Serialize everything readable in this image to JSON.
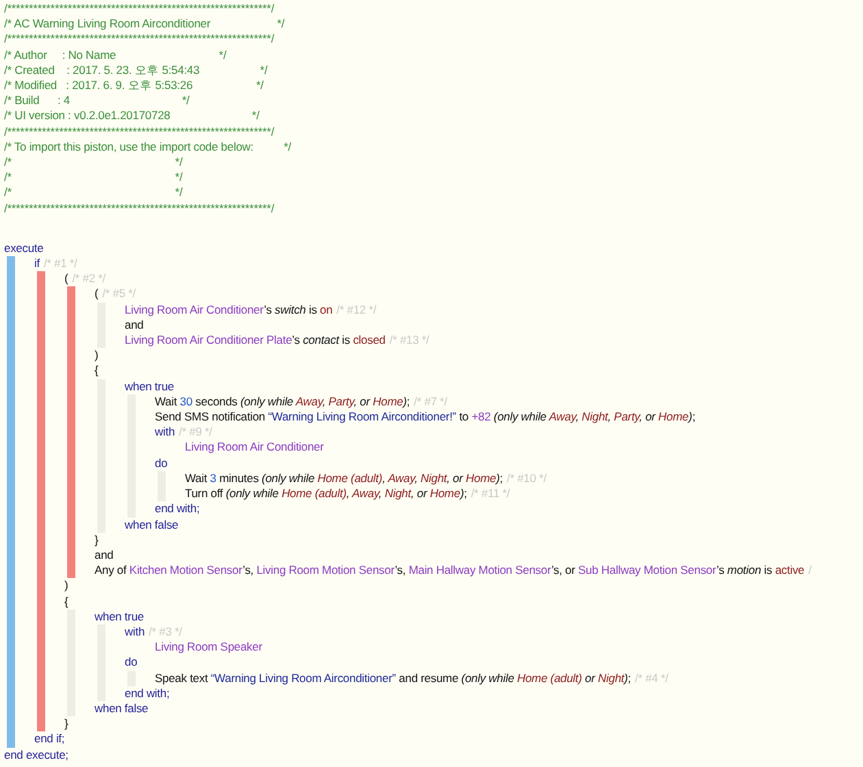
{
  "header": [
    "/*************************************************************/",
    "/* AC Warning Living Room Airconditioner                      */",
    "/*************************************************************/",
    "/* Author     : No Name                                  */",
    "/* Created    : 2017. 5. 23. 오후 5:54:43                    */",
    "/* Modified   : 2017. 6. 9. 오후 5:53:26                     */",
    "/* Build      : 4                                     */",
    "/* UI version : v0.2.0e1.20170728                           */",
    "/*************************************************************/",
    "/* To import this piston, use the import code below:          */",
    "/*                                                      */",
    "/*                                                      */",
    "/*                                                      */",
    "/*************************************************************/"
  ],
  "code": [
    {
      "segments": [
        {
          "kind": "kw",
          "text": "execute"
        }
      ],
      "kind": "execute",
      "children": [
        {
          "segments": [
            {
              "kind": "kw",
              "text": "if"
            },
            {
              "kind": "cm",
              "text": "/* #1 */"
            }
          ],
          "kind": "condition",
          "children": [
            {
              "segments": [
                {
                  "kind": "tx",
                  "text": "("
                },
                {
                  "kind": "cm",
                  "text": "/* #2 */"
                }
              ],
              "kind": "condition",
              "children": [
                {
                  "segments": [
                    {
                      "kind": "tx",
                      "text": "("
                    },
                    {
                      "kind": "cm",
                      "text": "/* #5 */"
                    }
                  ],
                  "kind": "block",
                  "children": [
                    {
                      "segments": [
                        {
                          "kind": "dv",
                          "text": "Living Room Air Conditioner"
                        },
                        {
                          "kind": "tx",
                          "text": "’s "
                        },
                        {
                          "kind": "at",
                          "text": "switch"
                        },
                        {
                          "kind": "tx",
                          "text": " is "
                        },
                        {
                          "kind": "vl",
                          "text": "on"
                        },
                        {
                          "kind": "cm",
                          "text": "/* #12 */"
                        }
                      ]
                    },
                    {
                      "segments": [
                        {
                          "kind": "tx",
                          "text": "and"
                        }
                      ]
                    },
                    {
                      "segments": [
                        {
                          "kind": "dv",
                          "text": "Living Room Air Conditioner Plate"
                        },
                        {
                          "kind": "tx",
                          "text": "’s "
                        },
                        {
                          "kind": "at",
                          "text": "contact"
                        },
                        {
                          "kind": "tx",
                          "text": " is "
                        },
                        {
                          "kind": "vl",
                          "text": "closed"
                        },
                        {
                          "kind": "cm",
                          "text": "/* #13 */"
                        }
                      ]
                    }
                  ]
                },
                {
                  "segments": [
                    {
                      "kind": "tx",
                      "text": ")"
                    }
                  ]
                },
                {
                  "segments": [
                    {
                      "kind": "tx",
                      "text": "{"
                    }
                  ],
                  "kind": "block",
                  "children": [
                    {
                      "segments": [
                        {
                          "kind": "kw",
                          "text": "when true"
                        }
                      ],
                      "kind": "block",
                      "children": [
                        {
                          "segments": [
                            {
                              "kind": "tx",
                              "text": "Wait "
                            },
                            {
                              "kind": "nm",
                              "text": "30"
                            },
                            {
                              "kind": "tx",
                              "text": " seconds "
                            },
                            {
                              "kind": "it",
                              "text": "(only while "
                            },
                            {
                              "kind": "md",
                              "text": "Away"
                            },
                            {
                              "kind": "it",
                              "text": ", "
                            },
                            {
                              "kind": "md",
                              "text": "Party"
                            },
                            {
                              "kind": "it",
                              "text": ", or "
                            },
                            {
                              "kind": "md",
                              "text": "Home"
                            },
                            {
                              "kind": "it",
                              "text": ")"
                            },
                            {
                              "kind": "tx",
                              "text": ";"
                            },
                            {
                              "kind": "cm",
                              "text": "/* #7 */"
                            }
                          ]
                        },
                        {
                          "segments": [
                            {
                              "kind": "tx",
                              "text": "Send SMS notification "
                            },
                            {
                              "kind": "st",
                              "text": "“Warning Living Room Airconditioner!”"
                            },
                            {
                              "kind": "tx",
                              "text": " to "
                            },
                            {
                              "kind": "dv",
                              "text": "+82"
                            },
                            {
                              "kind": "it",
                              "text": " (only while "
                            },
                            {
                              "kind": "md",
                              "text": "Away"
                            },
                            {
                              "kind": "it",
                              "text": ", "
                            },
                            {
                              "kind": "md",
                              "text": "Night"
                            },
                            {
                              "kind": "it",
                              "text": ", "
                            },
                            {
                              "kind": "md",
                              "text": "Party"
                            },
                            {
                              "kind": "it",
                              "text": ", or "
                            },
                            {
                              "kind": "md",
                              "text": "Home"
                            },
                            {
                              "kind": "it",
                              "text": ")"
                            },
                            {
                              "kind": "tx",
                              "text": ";"
                            }
                          ]
                        },
                        {
                          "segments": [
                            {
                              "kind": "kw",
                              "text": "with"
                            },
                            {
                              "kind": "cm",
                              "text": "/* #9 */"
                            }
                          ],
                          "kind": "group",
                          "children": [
                            {
                              "segments": [
                                {
                                  "kind": "dv",
                                  "text": "Living Room Air Conditioner"
                                }
                              ]
                            }
                          ]
                        },
                        {
                          "segments": [
                            {
                              "kind": "kw",
                              "text": "do"
                            }
                          ],
                          "kind": "block",
                          "children": [
                            {
                              "segments": [
                                {
                                  "kind": "tx",
                                  "text": "Wait "
                                },
                                {
                                  "kind": "nm",
                                  "text": "3"
                                },
                                {
                                  "kind": "tx",
                                  "text": " minutes "
                                },
                                {
                                  "kind": "it",
                                  "text": "(only while "
                                },
                                {
                                  "kind": "md",
                                  "text": "Home (adult)"
                                },
                                {
                                  "kind": "it",
                                  "text": ", "
                                },
                                {
                                  "kind": "md",
                                  "text": "Away"
                                },
                                {
                                  "kind": "it",
                                  "text": ", "
                                },
                                {
                                  "kind": "md",
                                  "text": "Night"
                                },
                                {
                                  "kind": "it",
                                  "text": ", or "
                                },
                                {
                                  "kind": "md",
                                  "text": "Home"
                                },
                                {
                                  "kind": "it",
                                  "text": ")"
                                },
                                {
                                  "kind": "tx",
                                  "text": ";"
                                },
                                {
                                  "kind": "cm",
                                  "text": "/* #10 */"
                                }
                              ]
                            },
                            {
                              "segments": [
                                {
                                  "kind": "tx",
                                  "text": "Turn off "
                                },
                                {
                                  "kind": "it",
                                  "text": "(only while "
                                },
                                {
                                  "kind": "md",
                                  "text": "Home (adult)"
                                },
                                {
                                  "kind": "it",
                                  "text": ", "
                                },
                                {
                                  "kind": "md",
                                  "text": "Away"
                                },
                                {
                                  "kind": "it",
                                  "text": ", "
                                },
                                {
                                  "kind": "md",
                                  "text": "Night"
                                },
                                {
                                  "kind": "it",
                                  "text": ", or "
                                },
                                {
                                  "kind": "md",
                                  "text": "Home"
                                },
                                {
                                  "kind": "it",
                                  "text": ")"
                                },
                                {
                                  "kind": "tx",
                                  "text": ";"
                                },
                                {
                                  "kind": "cm",
                                  "text": "/* #11 */"
                                }
                              ]
                            }
                          ]
                        },
                        {
                          "segments": [
                            {
                              "kind": "kw",
                              "text": "end with;"
                            }
                          ]
                        }
                      ]
                    },
                    {
                      "segments": [
                        {
                          "kind": "kw",
                          "text": "when false"
                        }
                      ]
                    }
                  ]
                },
                {
                  "segments": [
                    {
                      "kind": "tx",
                      "text": "}"
                    }
                  ]
                },
                {
                  "segments": [
                    {
                      "kind": "tx",
                      "text": "and"
                    }
                  ]
                },
                {
                  "segments": [
                    {
                      "kind": "tx",
                      "text": "Any of "
                    },
                    {
                      "kind": "dv",
                      "text": "Kitchen Motion Sensor"
                    },
                    {
                      "kind": "tx",
                      "text": "’s, "
                    },
                    {
                      "kind": "dv",
                      "text": "Living Room Motion Sensor"
                    },
                    {
                      "kind": "tx",
                      "text": "’s, "
                    },
                    {
                      "kind": "dv",
                      "text": "Main Hallway Motion Sensor"
                    },
                    {
                      "kind": "tx",
                      "text": "’s, or "
                    },
                    {
                      "kind": "dv",
                      "text": "Sub Hallway Motion Sensor"
                    },
                    {
                      "kind": "tx",
                      "text": "’s "
                    },
                    {
                      "kind": "at",
                      "text": "motion"
                    },
                    {
                      "kind": "tx",
                      "text": " is "
                    },
                    {
                      "kind": "vl",
                      "text": "active"
                    },
                    {
                      "kind": "cm",
                      "text": "/"
                    }
                  ]
                }
              ]
            },
            {
              "segments": [
                {
                  "kind": "tx",
                  "text": ")"
                }
              ]
            },
            {
              "segments": [
                {
                  "kind": "tx",
                  "text": "{"
                }
              ],
              "kind": "block",
              "children": [
                {
                  "segments": [
                    {
                      "kind": "kw",
                      "text": "when true"
                    }
                  ],
                  "kind": "block",
                  "children": [
                    {
                      "segments": [
                        {
                          "kind": "kw",
                          "text": "with"
                        },
                        {
                          "kind": "cm",
                          "text": "/* #3 */"
                        }
                      ],
                      "kind": "group",
                      "children": [
                        {
                          "segments": [
                            {
                              "kind": "dv",
                              "text": "Living Room Speaker"
                            }
                          ]
                        }
                      ]
                    },
                    {
                      "segments": [
                        {
                          "kind": "kw",
                          "text": "do"
                        }
                      ],
                      "kind": "block",
                      "children": [
                        {
                          "segments": [
                            {
                              "kind": "tx",
                              "text": "Speak text "
                            },
                            {
                              "kind": "st",
                              "text": "“Warning Living Room Airconditioner”"
                            },
                            {
                              "kind": "tx",
                              "text": " and resume "
                            },
                            {
                              "kind": "it",
                              "text": "(only while "
                            },
                            {
                              "kind": "md",
                              "text": "Home (adult)"
                            },
                            {
                              "kind": "it",
                              "text": " or "
                            },
                            {
                              "kind": "md",
                              "text": "Night"
                            },
                            {
                              "kind": "it",
                              "text": ")"
                            },
                            {
                              "kind": "tx",
                              "text": ";"
                            },
                            {
                              "kind": "cm",
                              "text": "/* #4 */"
                            }
                          ]
                        }
                      ]
                    },
                    {
                      "segments": [
                        {
                          "kind": "kw",
                          "text": "end with;"
                        }
                      ]
                    }
                  ]
                },
                {
                  "segments": [
                    {
                      "kind": "kw",
                      "text": "when false"
                    }
                  ]
                }
              ]
            },
            {
              "segments": [
                {
                  "kind": "tx",
                  "text": "}"
                }
              ]
            }
          ]
        },
        {
          "segments": [
            {
              "kind": "kw",
              "text": "end if;"
            }
          ]
        }
      ]
    },
    {
      "segments": [
        {
          "kind": "kw",
          "text": "end execute;"
        }
      ]
    }
  ]
}
